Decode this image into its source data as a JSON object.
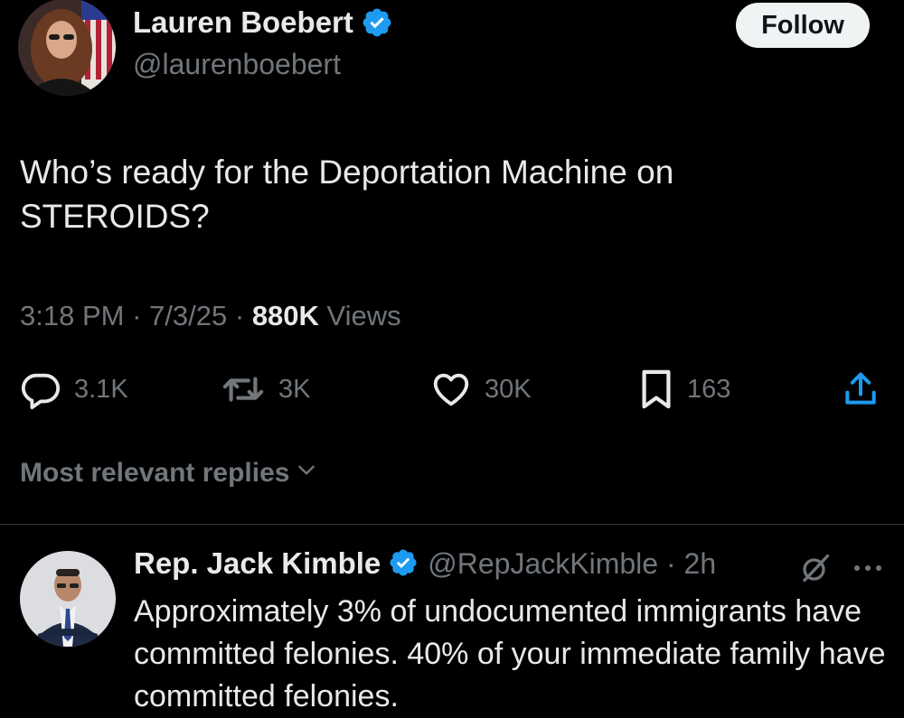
{
  "author": {
    "name": "Lauren Boebert",
    "handle": "@laurenboebert",
    "verified_icon": "verified-badge-icon",
    "follow_label": "Follow"
  },
  "tweet": {
    "text": "Who’s ready for the Deportation Machine on STEROIDS?",
    "time": "3:18 PM",
    "separator": "·",
    "date": "7/3/25",
    "views_count": "880K",
    "views_label": "Views"
  },
  "actions": {
    "replies": "3.1K",
    "reposts": "3K",
    "likes": "30K",
    "bookmarks": "163"
  },
  "replies_sort": {
    "label": "Most relevant replies"
  },
  "reply": {
    "name": "Rep. Jack Kimble",
    "handle_time": "@RepJackKimble · 2h",
    "text": "Approximately 3% of undocumented immigrants have committed felonies. 40% of your immediate family have committed felonies."
  },
  "colors": {
    "background": "#000000",
    "text_primary": "#e7e9ea",
    "text_secondary": "#71767b",
    "verified_blue": "#1d9bf0",
    "follow_bg": "#eff3f4"
  }
}
